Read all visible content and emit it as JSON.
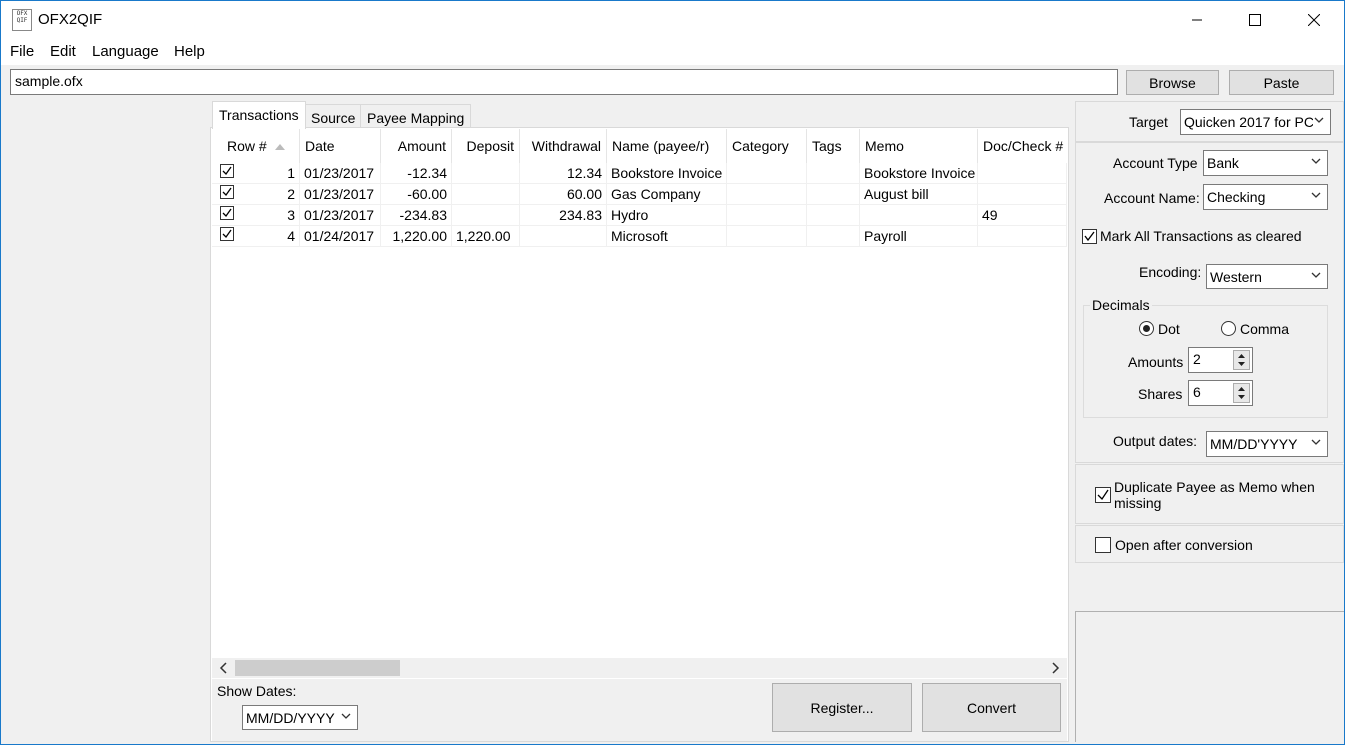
{
  "window": {
    "title": "OFX2QIF",
    "icon_text": "OFX QIF"
  },
  "menu": {
    "file": "File",
    "edit": "Edit",
    "language": "Language",
    "help": "Help"
  },
  "file_path": {
    "value": "sample.ofx"
  },
  "buttons": {
    "browse": "Browse",
    "paste": "Paste",
    "register": "Register...",
    "convert": "Convert"
  },
  "tabs": [
    {
      "label": "Transactions",
      "active": true
    },
    {
      "label": "Source",
      "active": false
    },
    {
      "label": "Payee Mapping",
      "active": false
    }
  ],
  "table": {
    "columns": [
      "Row #",
      "Date",
      "Amount",
      "Deposit",
      "Withdrawal",
      "Name (payee/r)",
      "Category",
      "Tags",
      "Memo",
      "Doc/Check #"
    ],
    "rows": [
      {
        "checked": true,
        "row": "1",
        "date": "01/23/2017",
        "amount": "-12.34",
        "deposit": "",
        "withdrawal": "12.34",
        "name": "Bookstore Invoice",
        "category": "",
        "tags": "",
        "memo": "Bookstore Invoice",
        "doc": ""
      },
      {
        "checked": true,
        "row": "2",
        "date": "01/23/2017",
        "amount": "-60.00",
        "deposit": "",
        "withdrawal": "60.00",
        "name": "Gas Company",
        "category": "",
        "tags": "",
        "memo": "August bill",
        "doc": ""
      },
      {
        "checked": true,
        "row": "3",
        "date": "01/23/2017",
        "amount": "-234.83",
        "deposit": "",
        "withdrawal": "234.83",
        "name": "Hydro",
        "category": "",
        "tags": "",
        "memo": "",
        "doc": "49"
      },
      {
        "checked": true,
        "row": "4",
        "date": "01/24/2017",
        "amount": "1,220.00",
        "deposit": "1,220.00",
        "withdrawal": "",
        "name": "Microsoft",
        "category": "",
        "tags": "",
        "memo": "Payroll",
        "doc": ""
      }
    ]
  },
  "show_dates": {
    "label": "Show Dates:",
    "value": "MM/DD/YYYY"
  },
  "settings": {
    "target_label": "Target",
    "target_value": "Quicken 2017 for PC",
    "account_type_label": "Account Type",
    "account_type_value": "Bank",
    "account_name_label": "Account Name:",
    "account_name_value": "Checking",
    "mark_cleared_label": "Mark All Transactions as cleared",
    "mark_cleared_checked": true,
    "encoding_label": "Encoding:",
    "encoding_value": "Western",
    "decimals_label": "Decimals",
    "dot_label": "Dot",
    "comma_label": "Comma",
    "decimal_selected": "Dot",
    "amounts_label": "Amounts",
    "amounts_value": "2",
    "shares_label": "Shares",
    "shares_value": "6",
    "output_dates_label": "Output dates:",
    "output_dates_value": "MM/DD'YYYY",
    "duplicate_payee_label_1": "Duplicate Payee as Memo when",
    "duplicate_payee_label_2": "missing",
    "duplicate_payee_checked": true,
    "open_after_label": "Open after conversion",
    "open_after_checked": false
  }
}
